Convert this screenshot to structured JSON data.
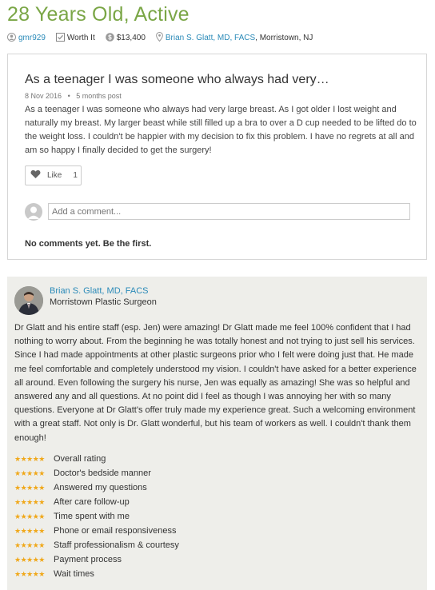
{
  "review": {
    "title": "28 Years Old, Active",
    "username": "gmr929",
    "worth_it": "Worth It",
    "cost": "$13,400",
    "doctor_link": "Brian S. Glatt, MD, FACS",
    "location": ", Morristown, NJ"
  },
  "post": {
    "title": "As a teenager I was someone who always had very…",
    "date": "8 Nov 2016",
    "separator": "•",
    "age": "5 months post",
    "body": "As a teenager I was someone who always had very large breast. As I got older I lost weight and naturally my breast. My larger beast while still filled up a bra to over a D cup needed to be lifted do to the weight loss. I couldn't be happier with my decision to fix this problem. I have no regrets at all and am so happy I finally decided to get the surgery!",
    "like_label": "Like",
    "like_count": "1",
    "comment_placeholder": "Add a comment...",
    "no_comments": "No comments yet. Be the first."
  },
  "doctor_review": {
    "name": "Brian S. Glatt, MD, FACS",
    "title": "Morristown Plastic Surgeon",
    "body": "Dr Glatt and his entire staff (esp. Jen) were amazing! Dr Glatt made me feel 100% confident that I had nothing to worry about. From the beginning he was totally honest and not trying to just sell his services. Since I had made appointments at other plastic surgeons prior who I felt were doing just that. He made me feel comfortable and completely understood my vision. I couldn't have asked for a better experience all around. Even following the surgery his nurse, Jen was equally as amazing! She was so helpful and answered any and all questions. At no point did I feel as though I was annoying her with so many questions. Everyone at Dr Glatt's offer truly made my experience great. Such a welcoming environment with a great staff. Not only is Dr. Glatt wonderful, but his team of workers as well. I couldn't thank them enough!",
    "star_color": "#f0a81a",
    "ratings": [
      {
        "label": "Overall rating",
        "stars": 5
      },
      {
        "label": "Doctor's bedside manner",
        "stars": 5
      },
      {
        "label": "Answered my questions",
        "stars": 5
      },
      {
        "label": "After care follow-up",
        "stars": 5
      },
      {
        "label": "Time spent with me",
        "stars": 5
      },
      {
        "label": "Phone or email responsiveness",
        "stars": 5
      },
      {
        "label": "Staff professionalism & courtesy",
        "stars": 5
      },
      {
        "label": "Payment process",
        "stars": 5
      },
      {
        "label": "Wait times",
        "stars": 5
      }
    ]
  },
  "colors": {
    "title_green": "#7aa646",
    "link_blue": "#2a8ab8",
    "review_bg": "#eeeeea"
  }
}
